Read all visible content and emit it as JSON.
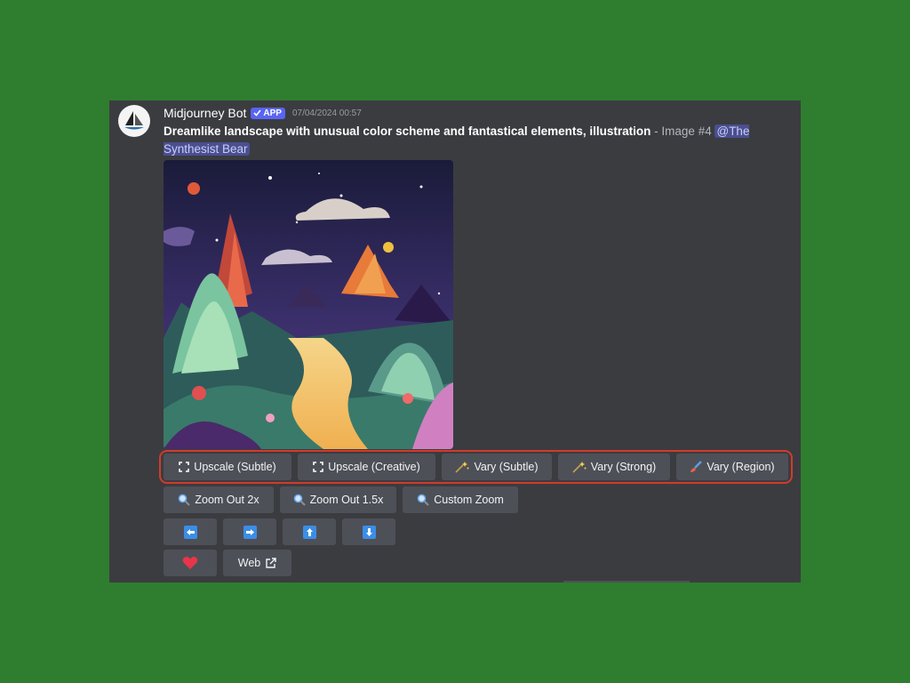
{
  "message": {
    "author": "Midjourney Bot",
    "badge": "APP",
    "timestamp": "07/04/2024 00:57",
    "prompt": "Dreamlike landscape with unusual color scheme and fantastical elements, illustration",
    "separator": " - ",
    "image_label": "Image #4",
    "mention": "@The Synthesist Bear"
  },
  "buttons": {
    "row1": [
      {
        "label": "Upscale (Subtle)",
        "icon": "expand-icon"
      },
      {
        "label": "Upscale (Creative)",
        "icon": "expand-icon"
      },
      {
        "label": "Vary (Subtle)",
        "icon": "sparkles-icon"
      },
      {
        "label": "Vary (Strong)",
        "icon": "sparkles-icon"
      },
      {
        "label": "Vary (Region)",
        "icon": "paintbrush-icon"
      }
    ],
    "row2": [
      {
        "label": "Zoom Out 2x",
        "icon": "magnifier-icon"
      },
      {
        "label": "Zoom Out 1.5x",
        "icon": "magnifier-icon"
      },
      {
        "label": "Custom Zoom",
        "icon": "magnifier-icon"
      }
    ],
    "row3": [
      {
        "icon": "arrow-left-icon"
      },
      {
        "icon": "arrow-right-icon"
      },
      {
        "icon": "arrow-up-icon"
      },
      {
        "icon": "arrow-down-icon"
      }
    ],
    "row4": [
      {
        "icon": "heart-icon"
      },
      {
        "label": "Web",
        "icon": "external-link-icon"
      }
    ]
  },
  "colors": {
    "background": "#2f7d2f",
    "panel": "#3b3c40",
    "button": "#4e5058",
    "highlight": "#d43a2a",
    "badge": "#5865f2",
    "mention": "#4a4f8f"
  }
}
